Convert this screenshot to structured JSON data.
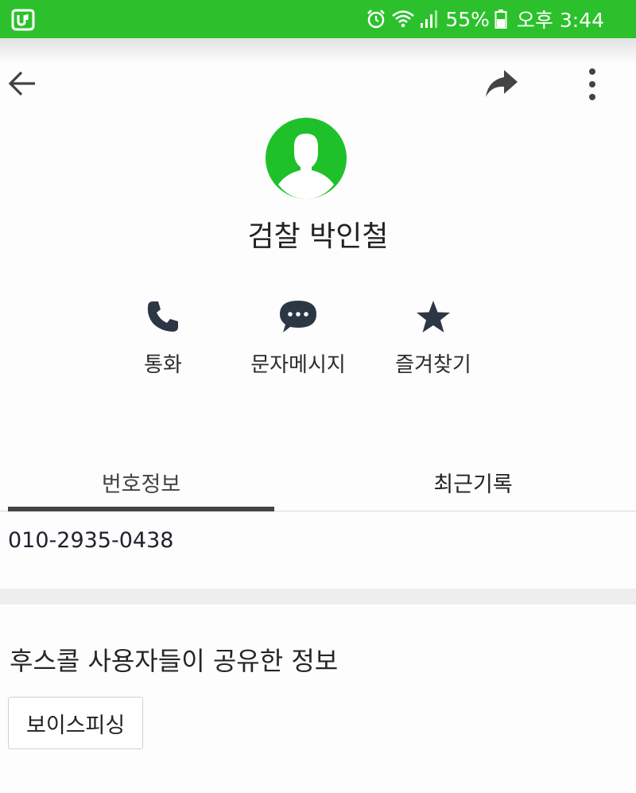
{
  "status_bar": {
    "battery_percent": "55%",
    "time": "오후 3:44",
    "background_color": "#2cc12c",
    "icons": [
      "app-u-icon",
      "alarm-icon",
      "wifi-icon",
      "signal-icon",
      "battery-icon"
    ]
  },
  "toolbar": {
    "icons": [
      "back-arrow-icon",
      "share-icon",
      "more-vertical-icon"
    ]
  },
  "contact": {
    "name": "검찰 박인철",
    "avatar_color": "#1fc12b"
  },
  "actions": [
    {
      "label": "통화",
      "icon": "phone-icon"
    },
    {
      "label": "문자메시지",
      "icon": "chat-bubble-icon"
    },
    {
      "label": "즐겨찾기",
      "icon": "star-icon"
    }
  ],
  "tabs": [
    {
      "label": "번호정보",
      "selected": true
    },
    {
      "label": "최근기록",
      "selected": false
    }
  ],
  "number_info": {
    "phone_number": "010-2935-0438"
  },
  "shared_info": {
    "title": "후스콜 사용자들이 공유한 정보",
    "tags": [
      "보이스피싱"
    ]
  }
}
